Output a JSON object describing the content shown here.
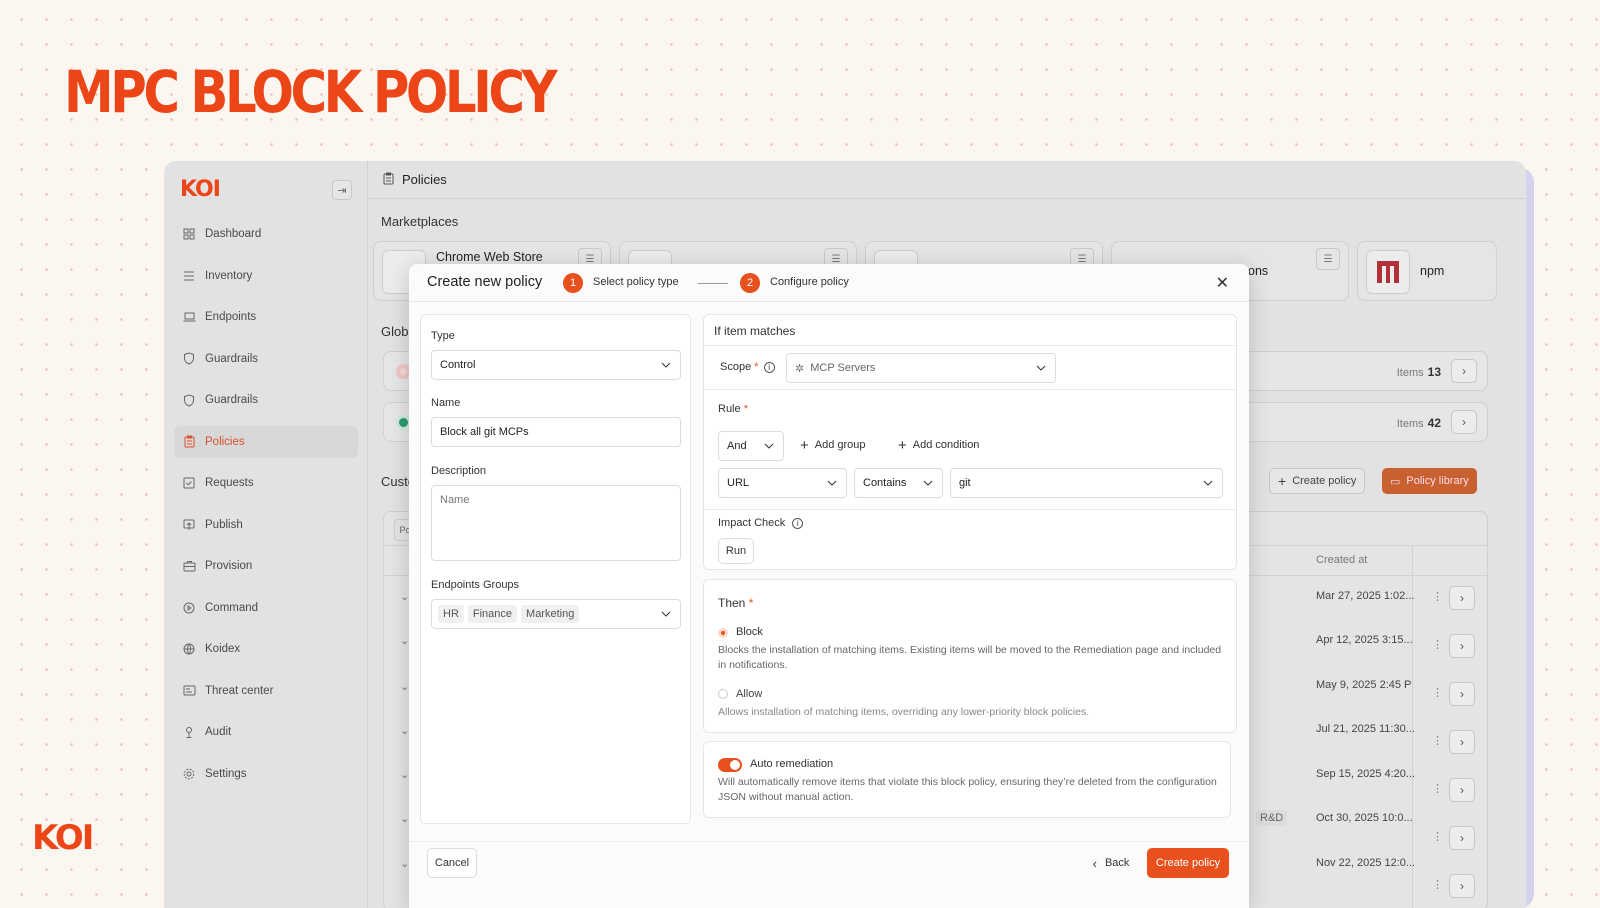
{
  "hero_title": "MPC BLOCK POLICY",
  "brand": "KOI",
  "sidebar": {
    "logo": "KOI",
    "items": [
      {
        "label": "Dashboard",
        "icon": "grid-icon"
      },
      {
        "label": "Inventory",
        "icon": "list-icon"
      },
      {
        "label": "Endpoints",
        "icon": "laptop-icon"
      },
      {
        "label": "Guardrails",
        "icon": "shield-icon"
      },
      {
        "label": "Guardrails",
        "icon": "shield-icon"
      },
      {
        "label": "Policies",
        "icon": "clipboard-icon"
      },
      {
        "label": "Requests",
        "icon": "checklist-icon"
      },
      {
        "label": "Publish",
        "icon": "upload-icon"
      },
      {
        "label": "Provision",
        "icon": "briefcase-icon"
      },
      {
        "label": "Command",
        "icon": "play-circle-icon"
      },
      {
        "label": "Koidex",
        "icon": "globe-icon"
      },
      {
        "label": "Threat center",
        "icon": "id-card-icon"
      },
      {
        "label": "Audit",
        "icon": "user-icon"
      },
      {
        "label": "Settings",
        "icon": "gear-icon"
      }
    ]
  },
  "page": {
    "title": "Policies",
    "marketplaces_label": "Marketplaces",
    "global_label": "Globa",
    "custom_label": "Custo",
    "pol_tab": "Pol"
  },
  "marketplaces": [
    "Chrome Web Store",
    "",
    "",
    "ons",
    "npm"
  ],
  "global_rows": [
    {
      "items_label": "Items",
      "count": "13",
      "status_color": "#d1243a"
    },
    {
      "items_label": "Items",
      "count": "42",
      "status_color": "#1f8f6a"
    }
  ],
  "actions": {
    "create_policy": "Create policy",
    "policy_library": "Policy library"
  },
  "table": {
    "created_header": "Created at",
    "dates": [
      "Mar 27, 2025 1:02...",
      "Apr 12, 2025 3:15...",
      "May 9, 2025 2:45 P",
      "Jul 21, 2025 11:30...",
      "Sep 15, 2025 4:20...",
      "Oct 30, 2025 10:0...",
      "Nov 22, 2025 12:0..."
    ],
    "tag": "R&D"
  },
  "modal": {
    "title": "Create new policy",
    "steps": [
      {
        "num": "1",
        "label": "Select policy type"
      },
      {
        "num": "2",
        "label": "Configure policy"
      }
    ],
    "type_label": "Type",
    "type_value": "Control",
    "name_label": "Name",
    "name_value": "Block all git MCPs",
    "description_label": "Description",
    "description_placeholder": "Name",
    "endpoints_label": "Endpoints Groups",
    "endpoints_chips": [
      "HR",
      "Finance",
      "Marketing"
    ],
    "if_label": "If item matches",
    "scope_label": "Scope",
    "scope_value": "MCP Servers",
    "rule_label": "Rule",
    "rule_op": "And",
    "add_group": "Add group",
    "add_condition": "Add condition",
    "cond_field": "URL",
    "cond_op": "Contains",
    "cond_value": "git",
    "impact_label": "Impact Check",
    "run": "Run",
    "then_label": "Then",
    "block_label": "Block",
    "block_desc": "Blocks the installation of matching items. Existing items will be moved to the Remediation page and included in notifications.",
    "allow_label": "Allow",
    "allow_desc": "Allows installation of matching items, overriding any lower-priority block policies.",
    "auto_label": "Auto remediation",
    "auto_desc": "Will automatically remove items that violate this block policy, ensuring they’re deleted from the configuration JSON without manual action.",
    "cancel": "Cancel",
    "back": "Back",
    "create": "Create policy",
    "required_mark": "*",
    "accent": "#e8501d"
  }
}
